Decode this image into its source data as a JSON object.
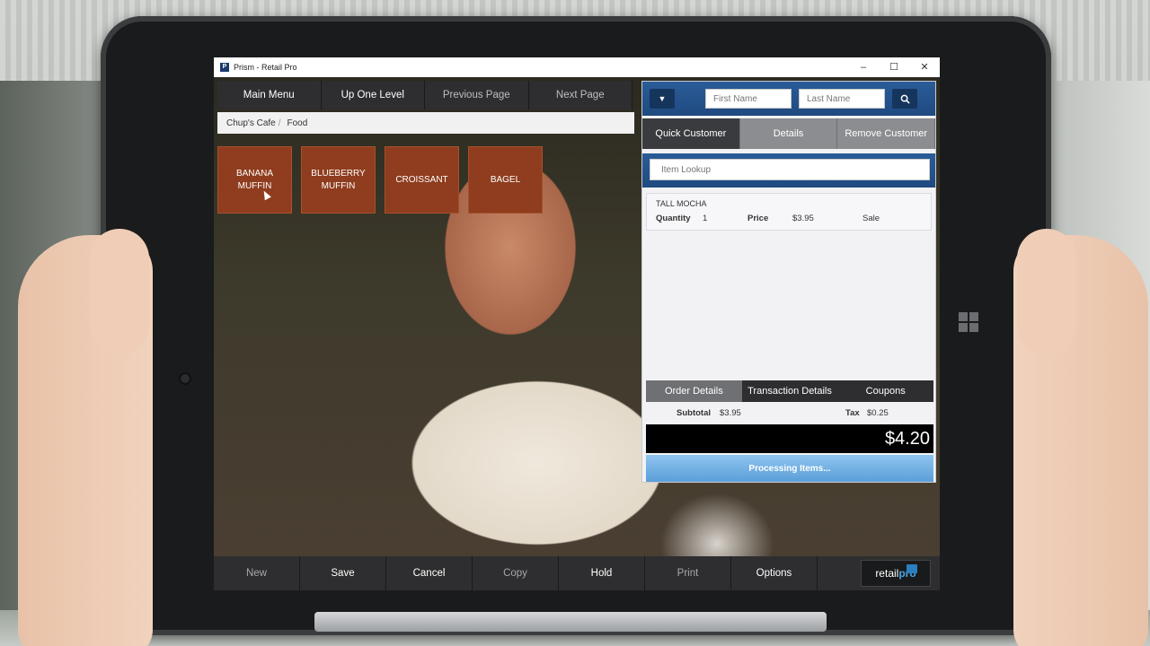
{
  "window": {
    "title": "Prism - Retail Pro",
    "logo_text": "P",
    "controls": [
      "–",
      "☐",
      "✕"
    ]
  },
  "nav": {
    "main_menu": "Main Menu",
    "up_one_level": "Up One Level",
    "previous_page": "Previous Page",
    "next_page": "Next Page"
  },
  "breadcrumb": {
    "root": "Chup's Cafe",
    "separator": "/",
    "current": "Food"
  },
  "tiles": [
    {
      "line1": "BANANA",
      "line2": "MUFFIN"
    },
    {
      "line1": "BLUEBERRY",
      "line2": "MUFFIN"
    },
    {
      "line1": "CROISSANT",
      "line2": ""
    },
    {
      "line1": "BAGEL",
      "line2": ""
    }
  ],
  "customer": {
    "first_name_placeholder": "First Name",
    "last_name_placeholder": "Last Name",
    "tabs": [
      "Quick Customer",
      "Details",
      "Remove Customer"
    ]
  },
  "item_lookup": {
    "placeholder": "Item Lookup"
  },
  "line_item": {
    "name": "TALL MOCHA",
    "quantity_label": "Quantity",
    "quantity": "1",
    "price_label": "Price",
    "price": "$3.95",
    "status": "Sale"
  },
  "order_tabs": [
    "Order Details",
    "Transaction Details",
    "Coupons"
  ],
  "totals": {
    "subtotal_label": "Subtotal",
    "subtotal": "$3.95",
    "tax_label": "Tax",
    "tax": "$0.25",
    "grand_total": "$4.20"
  },
  "processing": "Processing Items...",
  "toolbar": {
    "new": "New",
    "save": "Save",
    "cancel": "Cancel",
    "copy": "Copy",
    "hold": "Hold",
    "print": "Print",
    "options": "Options"
  },
  "brand": {
    "retail": "retail",
    "pro": "pro"
  },
  "colors": {
    "tile": "#8f3d1e",
    "header_blue": "#1f4a80",
    "toolbar": "#2e2e30",
    "processing": "#5a9fd8"
  }
}
